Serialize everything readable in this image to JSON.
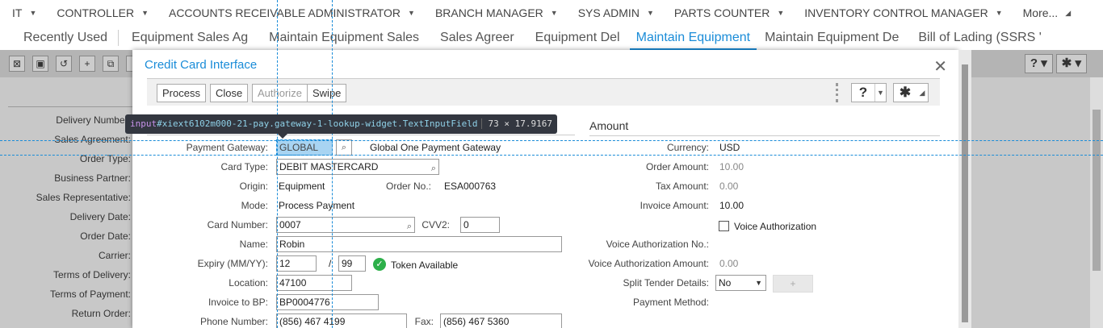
{
  "roles": [
    {
      "label": "IT"
    },
    {
      "label": "CONTROLLER"
    },
    {
      "label": "ACCOUNTS RECEIVABLE ADMINISTRATOR"
    },
    {
      "label": "BRANCH MANAGER"
    },
    {
      "label": "SYS ADMIN"
    },
    {
      "label": "PARTS COUNTER"
    },
    {
      "label": "INVENTORY CONTROL MANAGER"
    },
    {
      "label": "More..."
    }
  ],
  "tabs": [
    {
      "label": "Recently Used"
    },
    {
      "label": "Equipment Sales Ag"
    },
    {
      "label": "Maintain Equipment Sales"
    },
    {
      "label": "Sales Agreer"
    },
    {
      "label": "Equipment Del"
    },
    {
      "label": "Maintain Equipment"
    },
    {
      "label": "Maintain Equipment De"
    },
    {
      "label": "Bill of Lading (SSRS '"
    }
  ],
  "background_form": {
    "labels": [
      "Delivery Number:",
      "Sales Agreement:",
      "Order Type:",
      "Business Partner:",
      "Sales Representative:",
      "Delivery Date:",
      "Order Date:",
      "Carrier:",
      "Terms of Delivery:",
      "Terms of Payment:",
      "Return Order:"
    ]
  },
  "dialog": {
    "title": "Credit Card Interface",
    "toolbar": {
      "process": "Process",
      "close": "Close",
      "authorize": "Authorize",
      "swipe": "Swipe",
      "help_icon": "?",
      "settings_icon": "gear-icon"
    },
    "amount_section": "Amount",
    "fields": {
      "payment_gateway_label": "Payment Gateway:",
      "payment_gateway_value": "GLOBAL",
      "payment_gateway_desc": "Global One Payment Gateway",
      "card_type_label": "Card Type:",
      "card_type_value": "DEBIT MASTERCARD",
      "origin_label": "Origin:",
      "origin_value": "Equipment",
      "order_no_label": "Order No.:",
      "order_no_value": "ESA000763",
      "mode_label": "Mode:",
      "mode_value": "Process Payment",
      "card_number_label": "Card Number:",
      "card_number_value": "0007",
      "cvv2_label": "CVV2:",
      "cvv2_value": "0",
      "name_label": "Name:",
      "name_value": "Robin",
      "expiry_label": "Expiry (MM/YY):",
      "expiry_month": "12",
      "expiry_sep": "/",
      "expiry_year": "99",
      "token_label": "Token Available",
      "location_label": "Location:",
      "location_value": "47100",
      "invoice_bp_label": "Invoice to BP:",
      "invoice_bp_value": "BP0004776",
      "phone_label": "Phone Number:",
      "phone_value": "(856) 467 4199",
      "fax_label": "Fax:",
      "fax_value": "(856) 467 5360"
    },
    "amounts": {
      "currency_label": "Currency:",
      "currency_value": "USD",
      "order_amount_label": "Order Amount:",
      "order_amount_value": "10.00",
      "tax_amount_label": "Tax Amount:",
      "tax_amount_value": "0.00",
      "invoice_amount_label": "Invoice Amount:",
      "invoice_amount_value": "10.00",
      "voice_auth_label": "Voice Authorization",
      "voice_auth_no_label": "Voice Authorization No.:",
      "voice_auth_amount_label": "Voice Authorization Amount:",
      "voice_auth_amount_value": "0.00",
      "split_tender_label": "Split Tender Details:",
      "split_tender_value": "No",
      "plus_label": "+",
      "payment_method_label": "Payment Method:"
    }
  },
  "inspector": {
    "tag": "input",
    "selector": "#xiext6102m000-21-pay.gateway-1-lookup-widget.TextInputField",
    "dims": "73 × 17.9167"
  }
}
